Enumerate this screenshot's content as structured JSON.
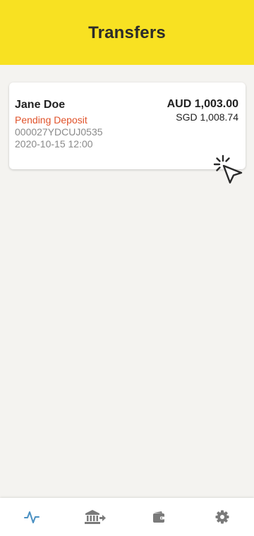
{
  "header": {
    "title": "Transfers"
  },
  "transfers": [
    {
      "name": "Jane Doe",
      "status": "Pending Deposit",
      "reference": "000027YDCUJ0535",
      "datetime": "2020-10-15 12:00",
      "amount_primary": "AUD 1,003.00",
      "amount_secondary": "SGD 1,008.74"
    }
  ],
  "tabbar": {
    "tabs": [
      {
        "icon": "activity-icon",
        "active": true
      },
      {
        "icon": "bank-transfer-icon",
        "active": false
      },
      {
        "icon": "wallet-icon",
        "active": false
      },
      {
        "icon": "gear-icon",
        "active": false
      }
    ]
  },
  "colors": {
    "header_bg": "#f8e122",
    "background": "#f4f3f0",
    "status_pending": "#e0522a",
    "tab_active": "#4a90c2",
    "tab_inactive": "#7a7a7a"
  }
}
